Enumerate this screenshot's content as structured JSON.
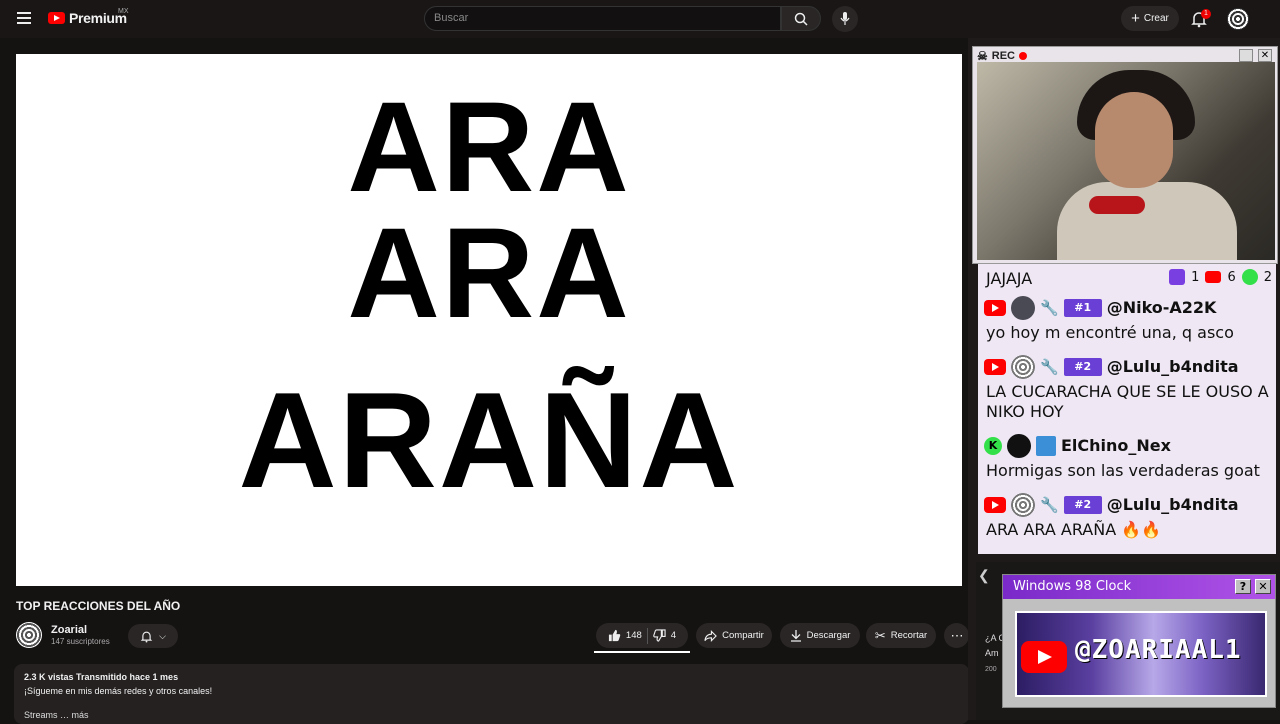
{
  "header": {
    "logo_text": "Premium",
    "logo_region": "MX",
    "search_placeholder": "Buscar",
    "create_label": "Crear",
    "notification_count": "1"
  },
  "player": {
    "lines": [
      "ARA",
      "ARA",
      "ARAÑA"
    ]
  },
  "video": {
    "title": "TOP REACCIONES DEL AÑO",
    "channel": "Zoarial",
    "subscribers": "147 suscriptores",
    "likes": "148",
    "dislikes": "4",
    "share_label": "Compartir",
    "download_label": "Descargar",
    "clip_label": "Recortar"
  },
  "description": {
    "stats": "2.3 K vistas  Transmitido hace 1 mes",
    "text": "¡Sígueme en mis demás redes y otros canales!",
    "more_line": "Streams … más"
  },
  "rec_window": {
    "title": "REC"
  },
  "chat": {
    "header": "JAJAJA",
    "platform_counts": {
      "twitch": "1",
      "youtube": "6",
      "kick": "2"
    },
    "messages": [
      {
        "platform": "youtube",
        "rank": "#1",
        "user": "@Niko-A22K",
        "text": "yo hoy m encontré una, q asco"
      },
      {
        "platform": "youtube",
        "rank": "#2",
        "user": "@Lulu_b4ndita",
        "text": "LA CUCARACHA QUE SE LE OUSO A NIKO HOY"
      },
      {
        "platform": "kick",
        "rank": "",
        "user": "ElChino_Nex",
        "text": "Hormigas son las verdaderas goat"
      },
      {
        "platform": "youtube",
        "rank": "#2",
        "user": "@Lulu_b4ndita",
        "text": "ARA ARA ARAÑA 🔥🔥"
      }
    ]
  },
  "clock_window": {
    "title": "Windows 98 Clock",
    "handle": "@ZOARIAAL1"
  },
  "side_fragments": {
    "frag1": "¿A C",
    "frag2": "Am",
    "frag3": "200"
  },
  "colors": {
    "accent_red": "#ff0000",
    "chat_bg": "#efe8f4",
    "clock_title": "#7a2ac9"
  }
}
